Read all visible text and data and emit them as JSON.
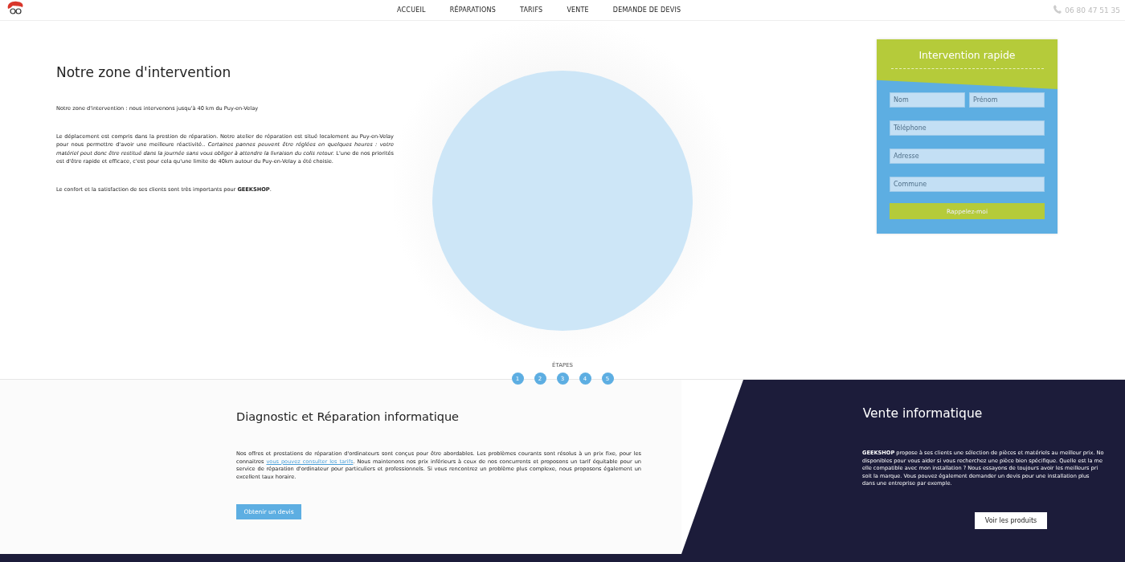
{
  "header": {
    "nav": [
      {
        "label": "ACCUEIL"
      },
      {
        "label": "RÉPARATIONS"
      },
      {
        "label": "TARIFS"
      },
      {
        "label": "VENTE"
      },
      {
        "label": "DEMANDE DE DEVIS"
      }
    ],
    "phone": "06 80 47 51 35"
  },
  "zone": {
    "title": "Notre zone d'intervention",
    "paragraphs": [
      "Notre zone d'intervention : nous intervenons jusqu'à 40 km du Puy-en-Velay",
      "Le déplacement est compris dans la prestion de réparation. Notre atelier de réparation est situé localement au Puy-en-Velay pour nous permettre d'avoir une meilleure réactivité.. *Certaines pannes peuvent être réglées en quelques heures : votre matériel peut donc être restitué dans la journée sans vous obliger à attendre la livraison du colis retour.* L'une de nos priorités est d'être rapide et efficace, c'est pour cela qu'une limite de 40km autour du Puy-en-Velay a été choisie.",
      "Le confort et la satisfaction de ses clients sont très importants pour **GEEKSHOP**."
    ]
  },
  "form": {
    "title": "Intervention rapide",
    "field_rows": [
      [
        {
          "placeholder": "Nom"
        },
        {
          "placeholder": "Prénom"
        }
      ],
      [
        {
          "placeholder": "Téléphone"
        }
      ],
      [
        {
          "placeholder": "Adresse"
        }
      ],
      [
        {
          "placeholder": "Commune"
        }
      ]
    ],
    "button": "Rappelez-moi"
  },
  "steps": {
    "label": "ÉTAPES",
    "items": [
      "1",
      "2",
      "3",
      "4",
      "5"
    ]
  },
  "repair": {
    "title": "Diagnostic et Réparation informatique",
    "text_before": "Nos offres et prestations de réparation d'ordinateurs sont conçus pour être abordables. Les problèmes courants sont résolus à un prix fixe, pour les connaitres ",
    "link": "vous pouvez consulter les tarifs",
    "text_after": ". Nous maintenons nos prix inférieurs à ceux de nos concurrents et proposons un tarif équitable pour un service de réparation d'ordinateur pour particuliers et professionnels. Si vous rencontrez un problème plus complexe, nous proposons également un excellent taux horaire.",
    "button": "Obtenir un devis"
  },
  "sales": {
    "title": "Vente informatique",
    "lines": [
      "**GEEKSHOP** propose à ses clients une sélection de pièces et matériels au meilleur prix. No",
      "disponibles pour vous aider si vous recherchez une pièce bien spécifique. Quelle est la me",
      "elle compatible avec mon installation ? Nous essayons de toujours avoir les meilleurs pri",
      "soit la marque. Vous pouvez également demander un devis pour une installation plus",
      "dans une entreprise par exemple."
    ],
    "button": "Voir les produits"
  }
}
